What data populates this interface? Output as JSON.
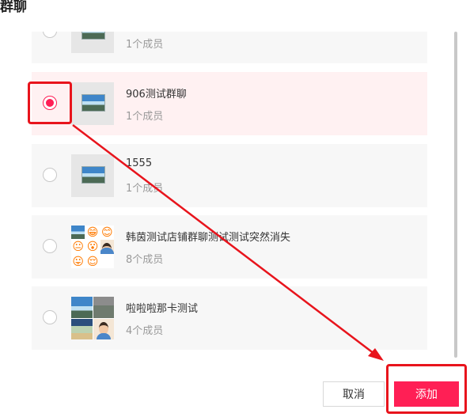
{
  "window": {
    "title": "群聊"
  },
  "groups": [
    {
      "name": "",
      "count": "1个成员",
      "selected": false
    },
    {
      "name": "906测试群聊",
      "count": "1个成员",
      "selected": true
    },
    {
      "name": "1555",
      "count": "1个成员",
      "selected": false
    },
    {
      "name": "韩茵测试店铺群聊测试测试突然消失",
      "count": "8个成员",
      "selected": false
    },
    {
      "name": "啦啦啦那卡测试",
      "count": "4个成员",
      "selected": false
    }
  ],
  "buttons": {
    "cancel": "取消",
    "add": "添加"
  },
  "colors": {
    "accent": "#ff1f55",
    "annotation": "#e8141c",
    "selected_row_bg": "#fff1f2"
  },
  "emoji_glyphs": [
    "😁",
    "😊",
    "😐",
    "😮",
    "😛",
    "😌"
  ]
}
